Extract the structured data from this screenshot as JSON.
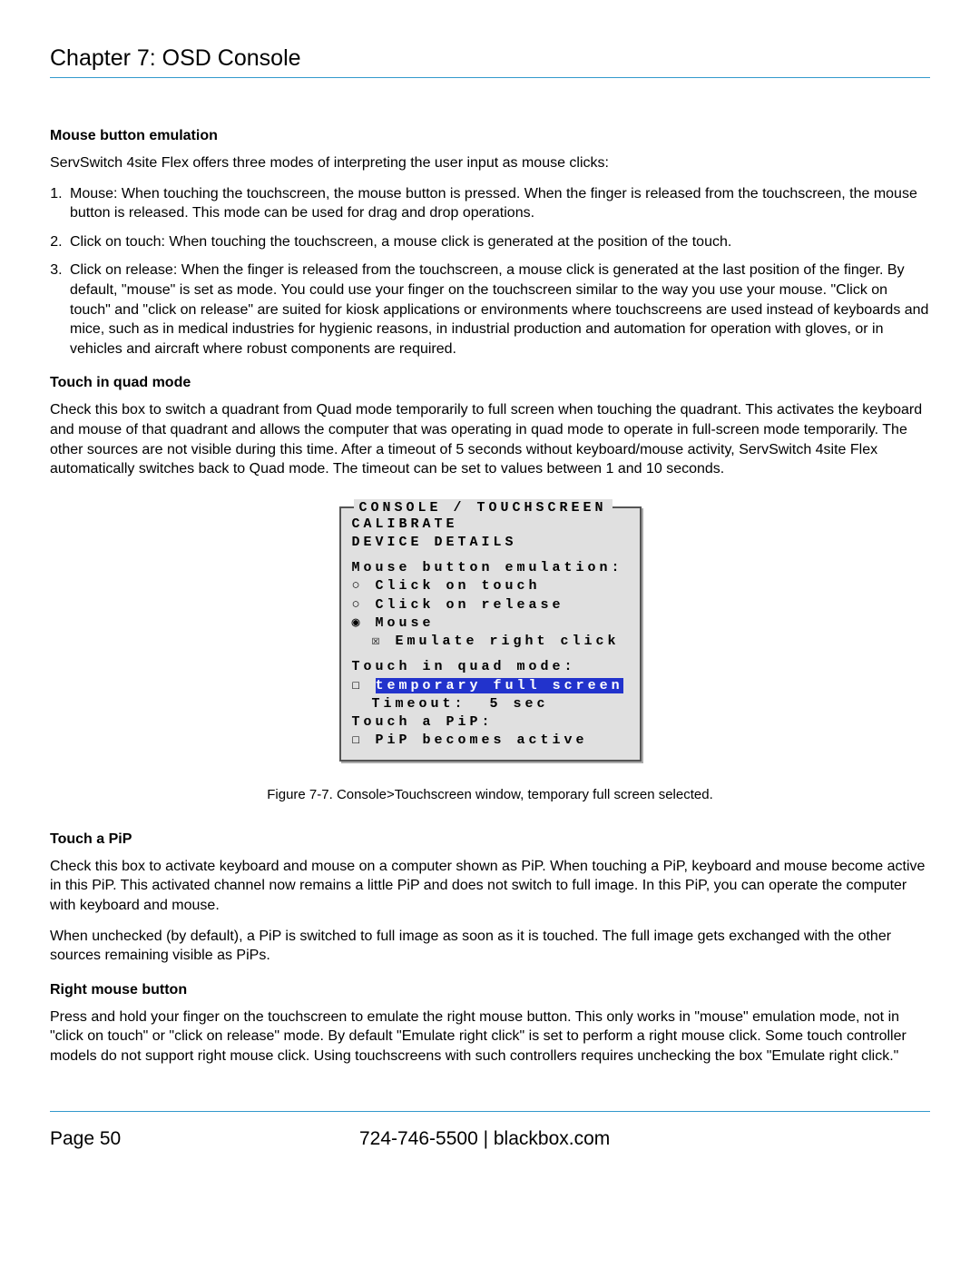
{
  "chapter_title": "Chapter 7: OSD Console",
  "sec1": {
    "heading": "Mouse button emulation",
    "intro": "ServSwitch 4site Flex offers three modes of interpreting the user input as mouse clicks:",
    "items": [
      "Mouse: When touching the touchscreen, the mouse button is pressed. When the finger is released from the touchscreen, the mouse button is released. This mode can be used for drag and drop operations.",
      "Click on touch: When touching the touchscreen, a mouse click is generated at the position of the touch.",
      "Click on release: When the finger is released from the touchscreen, a mouse click is generated at the last position of the finger. By default, \"mouse\" is set as mode. You could use your finger on the touchscreen similar to the way you use your mouse. \"Click on touch\" and \"click on release\" are suited for kiosk applications or environments where touchscreens are used instead of keyboards and mice, such as in medical industries for hygienic reasons, in industrial production and automation for operation with gloves, or in vehicles and aircraft where robust components are required."
    ]
  },
  "sec2": {
    "heading": "Touch in quad mode",
    "para": "Check this box to switch a quadrant from Quad mode temporarily to full screen when touching the quadrant. This activates the keyboard and mouse of that quadrant and allows the computer that was operating in quad mode to operate in full-screen mode temporarily. The other sources are not visible during this time. After a timeout of 5 seconds without keyboard/mouse activity, ServSwitch 4site Flex automatically switches back to Quad mode. The timeout can be set to values between 1 and 10 seconds."
  },
  "osd": {
    "title": "CONSOLE / TOUCHSCREEN",
    "lines": {
      "calibrate": "CALIBRATE",
      "device": "DEVICE DETAILS",
      "mbe": "Mouse button emulation:",
      "opt_touch": "○ Click on touch",
      "opt_release": "○ Click on release",
      "opt_mouse": "◉ Mouse",
      "emulate": "☒ Emulate right click",
      "tqm": "Touch in quad mode:",
      "tfs_box": "☐ ",
      "tfs_label": "temporary full screen",
      "timeout": "Timeout:  5 sec",
      "tap": "Touch a PiP:",
      "pip": "☐ PiP becomes active"
    }
  },
  "caption": "Figure 7-7. Console>Touchscreen window, temporary full screen selected.",
  "sec3": {
    "heading": "Touch a PiP",
    "p1": "Check this box to activate keyboard and mouse on a computer shown as PiP. When touching a PiP, keyboard and mouse become active in this PiP. This activated channel now remains a little PiP and does not switch to full image. In this PiP, you can operate the computer with keyboard and mouse.",
    "p2": "When unchecked (by default), a PiP is switched to full image as soon as it is touched. The full image gets exchanged with the other sources remaining visible as PiPs."
  },
  "sec4": {
    "heading": "Right mouse button",
    "p1": "Press and hold your finger on the touchscreen to emulate the right mouse button. This only works in \"mouse\" emulation mode, not in \"click on touch\" or \"click on release\" mode. By default \"Emulate right click\" is set to perform a right mouse click. Some touch controller models do not support right mouse click. Using touchscreens with such controllers requires unchecking the box \"Emulate right click.\""
  },
  "footer": {
    "page": "Page 50",
    "phone": "724-746-5500",
    "sep": "   |   ",
    "site": "blackbox.com"
  }
}
